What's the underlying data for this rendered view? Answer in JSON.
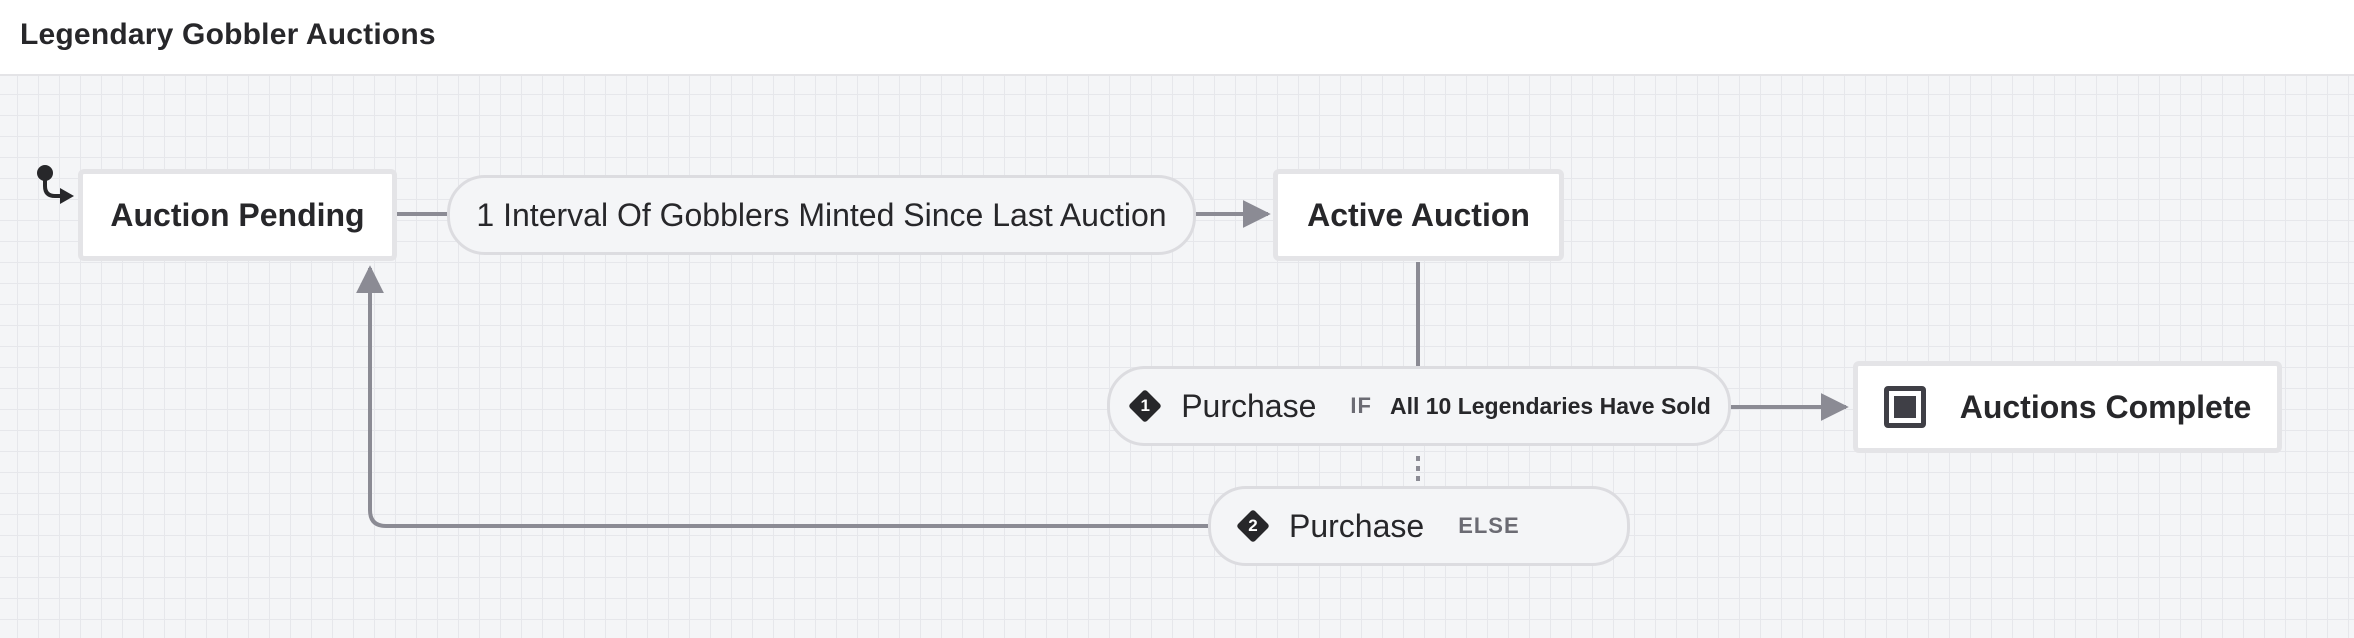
{
  "header": {
    "title": "Legendary Gobbler Auctions"
  },
  "states": {
    "auction_pending": "Auction Pending",
    "active_auction": "Active Auction",
    "auctions_complete": "Auctions Complete"
  },
  "events": {
    "interval_event": "1 Interval Of Gobblers Minted Since Last Auction",
    "purchase_if": {
      "badge": "1",
      "label": "Purchase",
      "keyword": "IF",
      "condition": "All 10 Legendaries Have Sold"
    },
    "purchase_else": {
      "badge": "2",
      "label": "Purchase",
      "keyword": "ELSE"
    }
  },
  "colors": {
    "edge": "#8b8b94",
    "node_border": "#e4e4e7",
    "canvas": "#f4f5f7",
    "text": "#27272a"
  },
  "icons": {
    "initial": "initial-state-icon",
    "final": "final-state-icon",
    "guard": "guard-diamond-icon"
  }
}
